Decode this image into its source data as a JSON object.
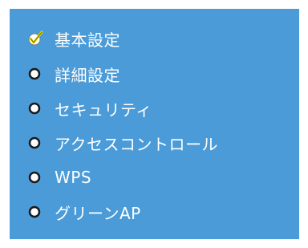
{
  "menu": {
    "items": [
      {
        "label": "基本設定",
        "icon": "checkmark-icon",
        "selected": true
      },
      {
        "label": "詳細設定",
        "icon": "radio-bullet-icon",
        "selected": false
      },
      {
        "label": "セキュリティ",
        "icon": "radio-bullet-icon",
        "selected": false
      },
      {
        "label": "アクセスコントロール",
        "icon": "radio-bullet-icon",
        "selected": false
      },
      {
        "label": "WPS",
        "icon": "radio-bullet-icon",
        "selected": false
      },
      {
        "label": "グリーンAP",
        "icon": "radio-bullet-icon",
        "selected": false
      }
    ]
  },
  "colors": {
    "panel_background": "#4a9bd8",
    "label_text": "#ffffff",
    "check_color": "#f0e000",
    "bullet_color": "#ffffff"
  }
}
